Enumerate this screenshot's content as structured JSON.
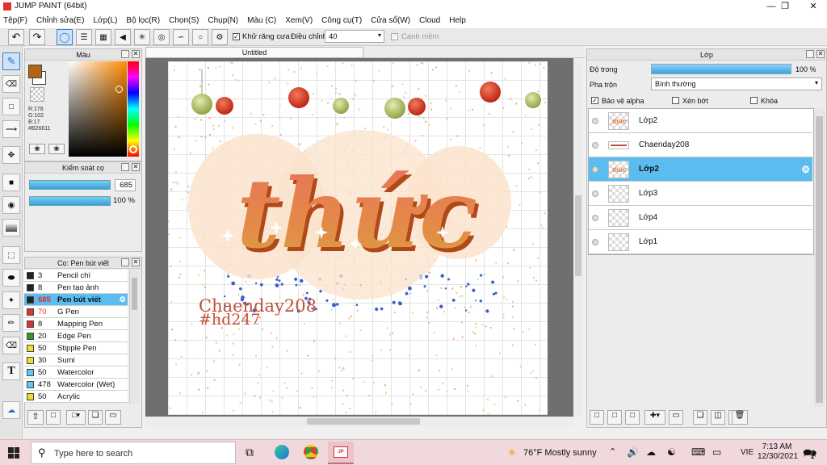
{
  "window": {
    "title": "JUMP PAINT (64bit)"
  },
  "menu": [
    "Tệp(F)",
    "Chỉnh sửa(E)",
    "Lớp(L)",
    "Bộ lọc(R)",
    "Chọn(S)",
    "Chụp(N)",
    "Màu (C)",
    "Xem(V)",
    "Công cụ(T)",
    "Cửa sổ(W)",
    "Cloud",
    "Help"
  ],
  "toolbar": {
    "antialias_label": "Khử răng cưa",
    "correction_label": "Điều chỉnh",
    "correction_value": "40",
    "edge_label": "Canh mềm"
  },
  "color_panel": {
    "title": "Màu",
    "r": "R:178",
    "g": "G:102",
    "b": "B:17",
    "hex": "#B26611",
    "fg_color": "#b26611",
    "bg_color": "#ffffff"
  },
  "brush_control": {
    "title": "Kiểm soát cọ",
    "size": "685",
    "opacity": "100 %"
  },
  "brush_panel": {
    "title": "Cọ: Pen bút viết",
    "items": [
      {
        "size": "3",
        "name": "Pencil chì",
        "color": "#222222"
      },
      {
        "size": "8",
        "name": "Pen tạo ảnh",
        "color": "#222222"
      },
      {
        "size": "685",
        "name": "Pen bút viết",
        "color": "#222222"
      },
      {
        "size": "70",
        "name": "G Pen",
        "color": "#e03030"
      },
      {
        "size": "8",
        "name": "Mapping Pen",
        "color": "#e03030"
      },
      {
        "size": "20",
        "name": "Edge Pen",
        "color": "#28a028"
      },
      {
        "size": "50",
        "name": "Stipple Pen",
        "color": "#e8e030"
      },
      {
        "size": "30",
        "name": "Sumi",
        "color": "#e8e030"
      },
      {
        "size": "50",
        "name": "Watercolor",
        "color": "#60c8f0"
      },
      {
        "size": "478",
        "name": "Watercolor (Wet)",
        "color": "#60c8f0"
      },
      {
        "size": "50",
        "name": "Acrylic",
        "color": "#e8e030"
      }
    ]
  },
  "canvas": {
    "tab_title": "Untitled",
    "artwork_title": "thức",
    "watermark_name": "Chaenday208",
    "watermark_tag": "#hd247"
  },
  "layer_panel": {
    "title": "Lớp",
    "opacity_label": "Độ trong",
    "opacity_value": "100 %",
    "opacity_fraction": 1.0,
    "blend_label": "Pha trộn",
    "blend_value": "Bình thường",
    "protect_alpha": "Bảo vệ alpha",
    "clipping": "Xén bớt",
    "lock": "Khóa",
    "layers": [
      {
        "name": "Lớp2"
      },
      {
        "name": "Chaenday208"
      },
      {
        "name": "Lớp2"
      },
      {
        "name": "Lớp3"
      },
      {
        "name": "Lớp4"
      },
      {
        "name": "Lớp1"
      }
    ]
  },
  "taskbar": {
    "search_placeholder": "Type here to search",
    "weather": "76°F  Mostly sunny",
    "lang": "VIE",
    "time": "7:13 AM",
    "date": "12/30/2021",
    "notifications": "2"
  }
}
